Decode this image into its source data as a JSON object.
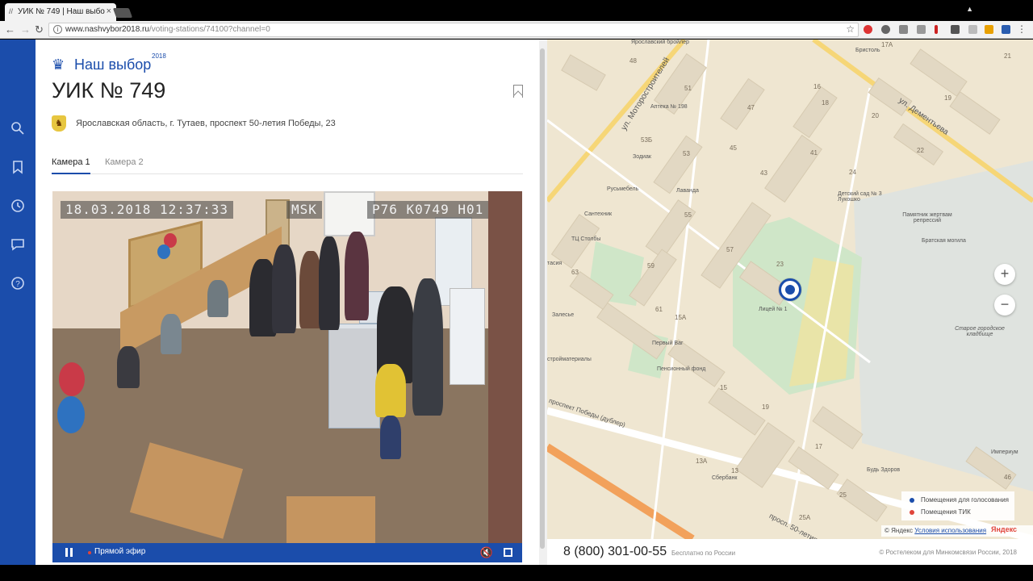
{
  "browser": {
    "tab_title": "УИК № 749 | Наш выбо",
    "url_domain": "www.nashvybor2018.ru",
    "url_path": "/voting-stations/74100?channel=0"
  },
  "logo": {
    "text": "Наш выбор",
    "year": "2018"
  },
  "page": {
    "title": "УИК № 749",
    "address": "Ярославская область, г. Тутаев, проспект 50-летия Победы, 23"
  },
  "tabs": [
    {
      "label": "Камера 1"
    },
    {
      "label": "Камера 2"
    }
  ],
  "video": {
    "timestamp": "18.03.2018 12:37:33",
    "tz": "MSK",
    "cam_id": "Р76 К0749 Н01",
    "live_label": "Прямой эфир"
  },
  "map": {
    "streets": [
      "ул. Моторостроителей",
      "ул. Дементьева",
      "проспект Победы (дублер)",
      "просп. 50-летия"
    ],
    "places": [
      "Ярославский бройлер",
      "Бристоль",
      "Аптека № 198",
      "Зодиак",
      "Русьмебель",
      "Лаванда",
      "Сантехник",
      "ТЦ Столбы",
      "Детский сад № 3 Лукошко",
      "Памятник жертвам репрессий",
      "Братская могила",
      "Лицей № 1",
      "Старое городское кладбище",
      "Залесье",
      "Первый Ваг",
      "Пенсионный фонд",
      "Сбербанк",
      "Будь Здоров",
      "Империум",
      "стройматериалы",
      "тасия"
    ],
    "house_numbers": [
      "48",
      "17А",
      "21",
      "47",
      "16",
      "18",
      "19",
      "20",
      "22",
      "53Б",
      "53",
      "45",
      "41",
      "43",
      "24",
      "55",
      "57",
      "59",
      "23",
      "63",
      "61",
      "15А",
      "15",
      "19",
      "17",
      "25",
      "13А",
      "13",
      "25А",
      "46",
      "51"
    ],
    "legend": [
      {
        "label": "Помещения для голосования",
        "color": "#1b4dab"
      },
      {
        "label": "Помещения ТИК",
        "color": "#e0443a"
      }
    ],
    "copyright_prefix": "© Яндекс",
    "terms_link": "Условия использования",
    "brand": "Яндекс"
  },
  "footer": {
    "phone": "8 (800) 301-00-55",
    "phone_note": "Бесплатно по России",
    "rights": "© Ростелеком для Минкомсвязи России, 2018"
  },
  "colors": {
    "brand_blue": "#1b4dab",
    "live_red": "#e0443a"
  },
  "icons": [
    "search-icon",
    "bookmark-icon",
    "history-icon",
    "chat-icon",
    "help-icon"
  ]
}
